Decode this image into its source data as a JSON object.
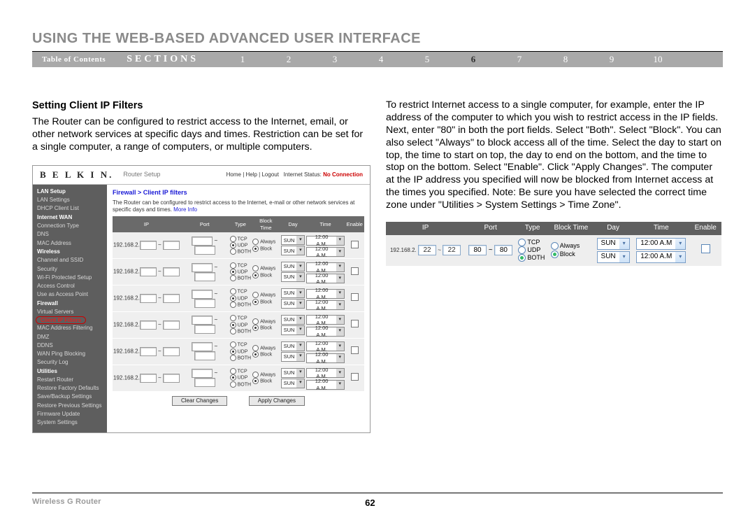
{
  "header": {
    "title": "USING THE WEB-BASED ADVANCED USER INTERFACE"
  },
  "nav": {
    "toc": "Table of Contents",
    "sections": "SECTIONS",
    "nums": [
      "1",
      "2",
      "3",
      "4",
      "5",
      "6",
      "7",
      "8",
      "9",
      "10"
    ],
    "current": "6"
  },
  "col_left": {
    "heading": "Setting Client IP Filters",
    "p1": "The Router can be configured to restrict access to the Internet, email, or other network services at specific days and times. Restriction can be set for a single computer, a range of computers, or multiple computers."
  },
  "col_right": {
    "p1": "To restrict Internet access to a single computer, for example, enter the IP address of the computer to which you wish to restrict access in the IP fields. Next, enter \"80\" in both the port fields. Select \"Both\". Select \"Block\". You can also select \"Always\" to block access all of the time. Select the day to start on top, the time to start on top, the day to end on the bottom, and the time to stop on the bottom. Select \"Enable\". Click \"Apply Changes\". The computer at the IP address you specified will now be blocked from Internet access at the times you specified. Note: Be sure you have selected the correct time zone under \"Utilities > System Settings > Time Zone\"."
  },
  "ui1": {
    "brand": "B E L K I N.",
    "setup": "Router Setup",
    "links": "Home | Help | Logout",
    "status_label": "Internet Status:",
    "status_val": "No Connection",
    "sidebar": [
      {
        "t": "LAN Setup",
        "cat": true
      },
      {
        "t": "LAN Settings"
      },
      {
        "t": "DHCP Client List"
      },
      {
        "t": "Internet WAN",
        "cat": true
      },
      {
        "t": "Connection Type"
      },
      {
        "t": "DNS"
      },
      {
        "t": "MAC Address"
      },
      {
        "t": "Wireless",
        "cat": true
      },
      {
        "t": "Channel and SSID"
      },
      {
        "t": "Security"
      },
      {
        "t": "Wi-Fi Protected Setup"
      },
      {
        "t": "Access Control"
      },
      {
        "t": "Use as Access Point"
      },
      {
        "t": "Firewall",
        "cat": true
      },
      {
        "t": "Virtual Servers"
      },
      {
        "t": "Client IP Filters",
        "sel": true
      },
      {
        "t": "MAC Address Filtering"
      },
      {
        "t": "DMZ"
      },
      {
        "t": "DDNS"
      },
      {
        "t": "WAN Ping Blocking"
      },
      {
        "t": "Security Log"
      },
      {
        "t": "Utilities",
        "cat": true
      },
      {
        "t": "Restart Router"
      },
      {
        "t": "Restore Factory Defaults"
      },
      {
        "t": "Save/Backup Settings"
      },
      {
        "t": "Restore Previous Settings"
      },
      {
        "t": "Firmware Update"
      },
      {
        "t": "System Settings"
      }
    ],
    "bc": "Firewall > Client IP filters",
    "desc": "The Router can be configured to restrict access to the Internet, e-mail or other network services at specific days and times.",
    "more": "More Info",
    "th": {
      "ip": "IP",
      "port": "Port",
      "type": "Type",
      "block": "Block Time",
      "day": "Day",
      "time": "Time",
      "en": "Enable"
    },
    "ip_prefix": "192.168.2.",
    "types": {
      "tcp": "TCP",
      "udp": "UDP",
      "both": "BOTH"
    },
    "bt": {
      "always": "Always",
      "block": "Block"
    },
    "day": "SUN",
    "time": "12:00 A.M.",
    "btn_clear": "Clear Changes",
    "btn_apply": "Apply Changes"
  },
  "ui2": {
    "th": {
      "ip": "IP",
      "port": "Port",
      "type": "Type",
      "block": "Block Time",
      "day": "Day",
      "time": "Time",
      "en": "Enable"
    },
    "ip_prefix": "192.168.2.",
    "ip_a": "22",
    "ip_b": "22",
    "port_a": "80",
    "port_b": "80",
    "types": {
      "tcp": "TCP",
      "udp": "UDP",
      "both": "BOTH"
    },
    "bt": {
      "always": "Always",
      "block": "Block"
    },
    "day": "SUN",
    "time": "12:00 A.M"
  },
  "footer": {
    "product": "Wireless G Router",
    "page": "62"
  }
}
